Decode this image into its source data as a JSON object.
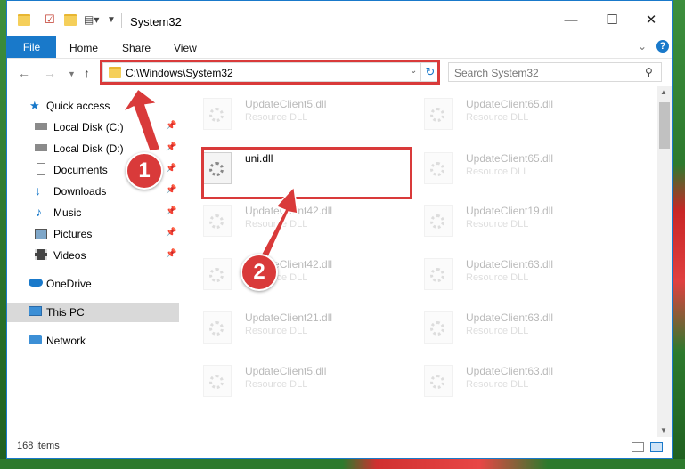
{
  "window": {
    "title": "System32"
  },
  "ribbon": {
    "tabs": [
      "File",
      "Home",
      "Share",
      "View"
    ],
    "help": "?"
  },
  "address": {
    "path": "C:\\Windows\\System32"
  },
  "search": {
    "placeholder": "Search System32"
  },
  "nav": {
    "items": [
      {
        "label": "Quick access",
        "icon": "star-icon"
      },
      {
        "label": "Local Disk (C:)",
        "icon": "drive-icon"
      },
      {
        "label": "Local Disk (D:)",
        "icon": "drive-icon"
      },
      {
        "label": "Documents",
        "icon": "documents-icon"
      },
      {
        "label": "Downloads",
        "icon": "download-arrow-icon"
      },
      {
        "label": "Music",
        "icon": "music-note-icon"
      },
      {
        "label": "Pictures",
        "icon": "pictures-icon"
      },
      {
        "label": "Videos",
        "icon": "film-icon"
      },
      {
        "label": "OneDrive",
        "icon": "cloud-icon"
      },
      {
        "label": "This PC",
        "icon": "monitor-icon"
      },
      {
        "label": "Network",
        "icon": "network-icon"
      }
    ]
  },
  "files": {
    "left": [
      {
        "name": "UpdateClient5.dll",
        "type": "Resource DLL"
      },
      {
        "name": "uni.dll",
        "type": ""
      },
      {
        "name": "UpdateClient42.dll",
        "type": "Resource DLL"
      },
      {
        "name": "UpdateClient42.dll",
        "type": "Resource DLL"
      },
      {
        "name": "UpdateClient21.dll",
        "type": "Resource DLL"
      },
      {
        "name": "UpdateClient5.dll",
        "type": "Resource DLL"
      }
    ],
    "right": [
      {
        "name": "UpdateClient65.dll",
        "type": "Resource DLL"
      },
      {
        "name": "UpdateClient65.dll",
        "type": "Resource DLL"
      },
      {
        "name": "UpdateClient19.dll",
        "type": "Resource DLL"
      },
      {
        "name": "UpdateClient63.dll",
        "type": "Resource DLL"
      },
      {
        "name": "UpdateClient63.dll",
        "type": "Resource DLL"
      },
      {
        "name": "UpdateClient63.dll",
        "type": "Resource DLL"
      }
    ]
  },
  "status": {
    "count": "168 items"
  },
  "annotations": {
    "step1": "1",
    "step2": "2"
  },
  "colors": {
    "accent": "#1979ca",
    "highlight": "#d93a3a"
  }
}
